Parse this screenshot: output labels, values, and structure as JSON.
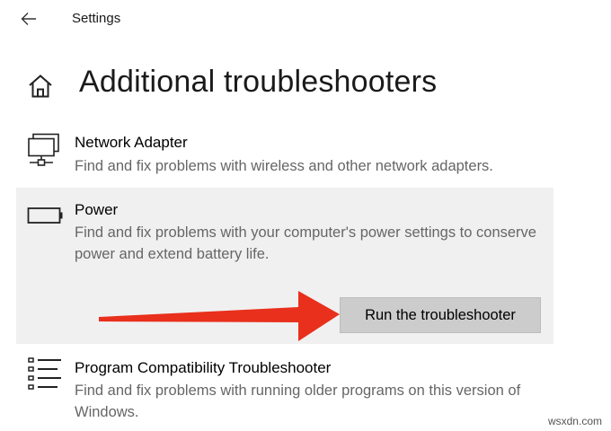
{
  "window": {
    "title": "Settings",
    "back_icon": "back-arrow-icon"
  },
  "header": {
    "title": "Additional troubleshooters",
    "home_icon": "home-icon"
  },
  "items": [
    {
      "title": "Network Adapter",
      "description": "Find and fix problems with wireless and other network adapters.",
      "icon": "network-adapter-icon",
      "selected": false
    },
    {
      "title": "Power",
      "description": "Find and fix problems with your computer's power settings to conserve power and extend battery life.",
      "icon": "battery-icon",
      "selected": true,
      "button_label": "Run the troubleshooter"
    },
    {
      "title": "Program Compatibility Troubleshooter",
      "description": "Find and fix problems with running older programs on this version of Windows.",
      "icon": "program-list-icon",
      "selected": false
    }
  ],
  "annotation": {
    "icon": "red-arrow-icon",
    "color": "#e8301c"
  },
  "colors": {
    "selected_background": "#f0f0f0",
    "button_background": "#cccccc",
    "description_text": "#666666"
  },
  "watermark": "wsxdn.com"
}
